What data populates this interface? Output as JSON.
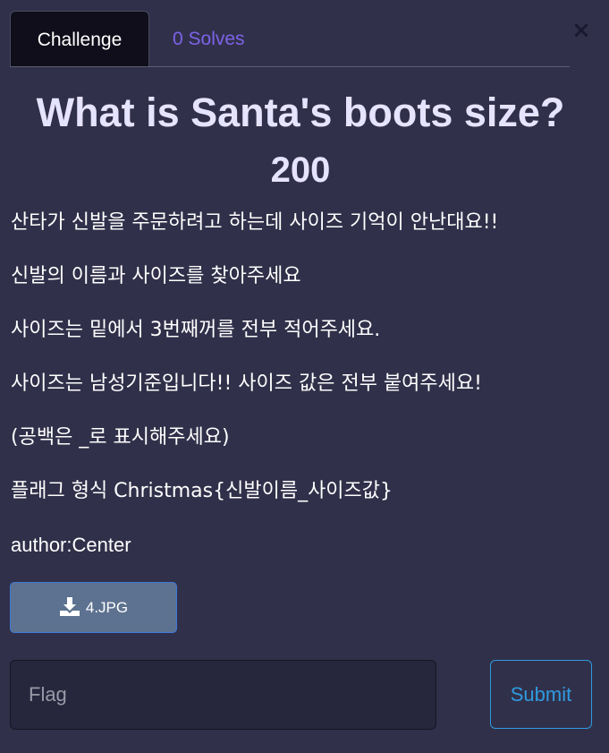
{
  "tabs": [
    {
      "label": "Challenge",
      "active": true
    },
    {
      "label": "0 Solves",
      "active": false
    }
  ],
  "close_symbol": "×",
  "challenge": {
    "title": "What is Santa's boots size?",
    "points": "200",
    "description": [
      "산타가 신발을 주문하려고 하는데 사이즈 기억이 안난대요!!",
      "신발의 이름과 사이즈를 찾아주세요",
      "사이즈는 밑에서 3번째꺼를 전부 적어주세요.",
      "사이즈는 남성기준입니다!! 사이즈 값은 전부 붙여주세요!",
      "(공백은 _로 표시해주세요)",
      "플래그 형식 Christmas{신발이름_사이즈값}"
    ],
    "author": "author:Center"
  },
  "download": {
    "label": "4.JPG",
    "icon": "download-icon"
  },
  "flag": {
    "placeholder": "Flag",
    "value": ""
  },
  "submit_label": "Submit",
  "colors": {
    "background": "#31304a",
    "tab_active_bg": "#0f0e1a",
    "tab_inactive_text": "#7c63e8",
    "title_text": "#e6e3ff",
    "download_bg": "#5d7290",
    "submit_accent": "#2f9be0"
  }
}
